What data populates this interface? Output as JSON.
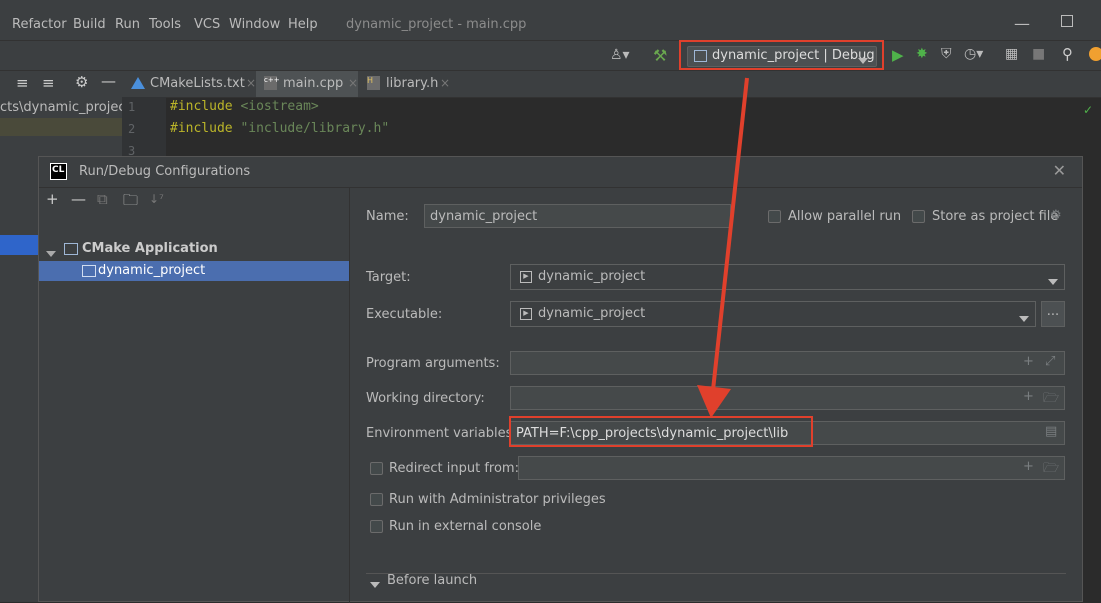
{
  "menu": {
    "items": [
      "Refactor",
      "Build",
      "Run",
      "Tools",
      "VCS",
      "Window",
      "Help"
    ],
    "window_title": "dynamic_project - main.cpp"
  },
  "toolbar": {
    "run_config": "dynamic_project | Debug"
  },
  "tabs": [
    {
      "label": "CMakeLists.txt"
    },
    {
      "label": "main.cpp"
    },
    {
      "label": "library.h"
    }
  ],
  "project_panel": {
    "item": "cts\\dynamic_project"
  },
  "editor": {
    "lines": [
      {
        "num": "1",
        "keyword": "#include",
        "arg": " <iostream>"
      },
      {
        "num": "2",
        "keyword": "#include",
        "arg": " \"include/library.h\""
      },
      {
        "num": "3",
        "keyword": "",
        "arg": ""
      }
    ]
  },
  "dialog": {
    "title": "Run/Debug Configurations",
    "tree": {
      "category": "CMake Application",
      "child": "dynamic_project"
    },
    "name_label": "Name:",
    "name_value": "dynamic_project",
    "allow_parallel": "Allow parallel run",
    "store_as_file": "Store as project file",
    "target_label": "Target:",
    "target_value": "dynamic_project",
    "executable_label": "Executable:",
    "executable_value": "dynamic_project",
    "browse_btn": "...",
    "program_args_label": "Program arguments:",
    "working_dir_label": "Working directory:",
    "env_label": "Environment variables:",
    "env_value": "PATH=F:\\cpp_projects\\dynamic_project\\lib",
    "redirect_label": "Redirect input from:",
    "admin_label": "Run with Administrator privileges",
    "external_console_label": "Run in external console",
    "before_launch": "Before launch"
  },
  "colors": {
    "highlight": "#e0402c",
    "selection": "#4b6eaf"
  }
}
